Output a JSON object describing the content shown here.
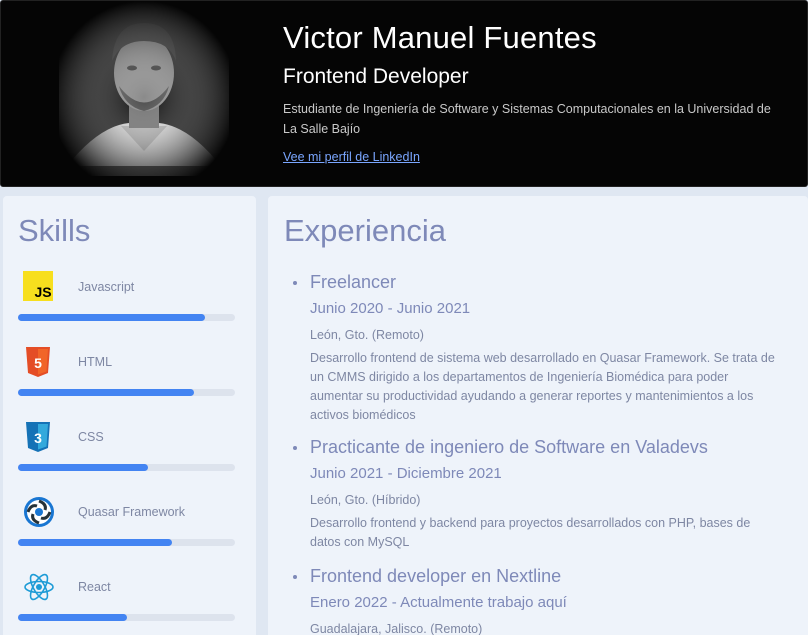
{
  "header": {
    "name": "Victor Manuel Fuentes",
    "role": "Frontend Developer",
    "description": "Estudiante de Ingeniería de Software y Sistemas Computacionales en la Universidad de La Salle Bajío",
    "linkedin_label": "Vee mi perfil de LinkedIn"
  },
  "skills": {
    "title": "Skills",
    "items": [
      {
        "label": "Javascript",
        "icon": "javascript-icon",
        "level": 0.86
      },
      {
        "label": "HTML",
        "icon": "html5-icon",
        "level": 0.81
      },
      {
        "label": "CSS",
        "icon": "css3-icon",
        "level": 0.6
      },
      {
        "label": "Quasar Framework",
        "icon": "quasar-icon",
        "level": 0.71
      },
      {
        "label": "React",
        "icon": "react-icon",
        "level": 0.5
      }
    ]
  },
  "experience": {
    "title": "Experiencia",
    "jobs": [
      {
        "title": "Freelancer",
        "dates": "Junio 2020 - Junio 2021",
        "location": "León, Gto. (Remoto)",
        "description": "Desarrollo frontend de sistema web desarrollado en Quasar Framework. Se trata de un CMMS dirigido a los departamentos de Ingeniería Biomédica para poder aumentar su productividad ayudando a generar reportes y mantenimientos a los activos biomédicos"
      },
      {
        "title": "Practicante de ingeniero de Software en Valadevs",
        "dates": "Junio 2021 - Diciembre 2021",
        "location": "León, Gto. (Híbrido)",
        "description": "Desarrollo frontend y backend para proyectos desarrollados con PHP, bases de datos con MySQL"
      },
      {
        "title": "Frontend developer en Nextline",
        "dates": "Enero 2022 - Actualmente trabajo aquí",
        "location": "Guadalajara, Jalisco. (Remoto)",
        "description": ""
      }
    ]
  },
  "colors": {
    "accent": "#4384f2",
    "heading": "#7e89b8",
    "header_bg": "#050505",
    "card_bg": "#eef3fa",
    "page_bg": "#dfe7f2"
  }
}
